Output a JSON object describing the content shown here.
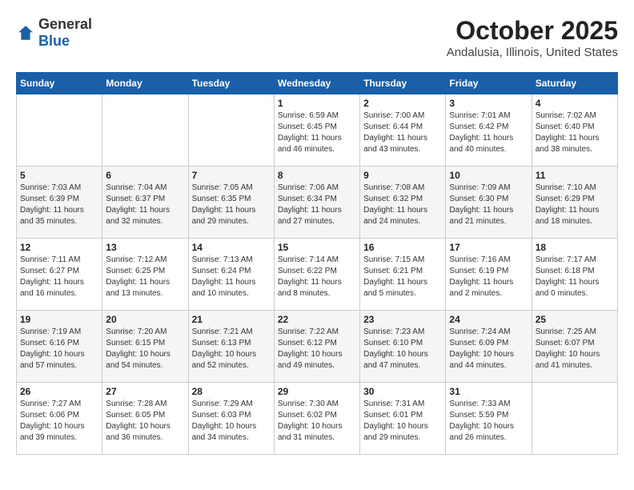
{
  "logo": {
    "general": "General",
    "blue": "Blue"
  },
  "title": "October 2025",
  "subtitle": "Andalusia, Illinois, United States",
  "days_of_week": [
    "Sunday",
    "Monday",
    "Tuesday",
    "Wednesday",
    "Thursday",
    "Friday",
    "Saturday"
  ],
  "weeks": [
    [
      {
        "day": "",
        "info": ""
      },
      {
        "day": "",
        "info": ""
      },
      {
        "day": "",
        "info": ""
      },
      {
        "day": "1",
        "info": "Sunrise: 6:59 AM\nSunset: 6:45 PM\nDaylight: 11 hours and 46 minutes."
      },
      {
        "day": "2",
        "info": "Sunrise: 7:00 AM\nSunset: 6:44 PM\nDaylight: 11 hours and 43 minutes."
      },
      {
        "day": "3",
        "info": "Sunrise: 7:01 AM\nSunset: 6:42 PM\nDaylight: 11 hours and 40 minutes."
      },
      {
        "day": "4",
        "info": "Sunrise: 7:02 AM\nSunset: 6:40 PM\nDaylight: 11 hours and 38 minutes."
      }
    ],
    [
      {
        "day": "5",
        "info": "Sunrise: 7:03 AM\nSunset: 6:39 PM\nDaylight: 11 hours and 35 minutes."
      },
      {
        "day": "6",
        "info": "Sunrise: 7:04 AM\nSunset: 6:37 PM\nDaylight: 11 hours and 32 minutes."
      },
      {
        "day": "7",
        "info": "Sunrise: 7:05 AM\nSunset: 6:35 PM\nDaylight: 11 hours and 29 minutes."
      },
      {
        "day": "8",
        "info": "Sunrise: 7:06 AM\nSunset: 6:34 PM\nDaylight: 11 hours and 27 minutes."
      },
      {
        "day": "9",
        "info": "Sunrise: 7:08 AM\nSunset: 6:32 PM\nDaylight: 11 hours and 24 minutes."
      },
      {
        "day": "10",
        "info": "Sunrise: 7:09 AM\nSunset: 6:30 PM\nDaylight: 11 hours and 21 minutes."
      },
      {
        "day": "11",
        "info": "Sunrise: 7:10 AM\nSunset: 6:29 PM\nDaylight: 11 hours and 18 minutes."
      }
    ],
    [
      {
        "day": "12",
        "info": "Sunrise: 7:11 AM\nSunset: 6:27 PM\nDaylight: 11 hours and 16 minutes."
      },
      {
        "day": "13",
        "info": "Sunrise: 7:12 AM\nSunset: 6:25 PM\nDaylight: 11 hours and 13 minutes."
      },
      {
        "day": "14",
        "info": "Sunrise: 7:13 AM\nSunset: 6:24 PM\nDaylight: 11 hours and 10 minutes."
      },
      {
        "day": "15",
        "info": "Sunrise: 7:14 AM\nSunset: 6:22 PM\nDaylight: 11 hours and 8 minutes."
      },
      {
        "day": "16",
        "info": "Sunrise: 7:15 AM\nSunset: 6:21 PM\nDaylight: 11 hours and 5 minutes."
      },
      {
        "day": "17",
        "info": "Sunrise: 7:16 AM\nSunset: 6:19 PM\nDaylight: 11 hours and 2 minutes."
      },
      {
        "day": "18",
        "info": "Sunrise: 7:17 AM\nSunset: 6:18 PM\nDaylight: 11 hours and 0 minutes."
      }
    ],
    [
      {
        "day": "19",
        "info": "Sunrise: 7:19 AM\nSunset: 6:16 PM\nDaylight: 10 hours and 57 minutes."
      },
      {
        "day": "20",
        "info": "Sunrise: 7:20 AM\nSunset: 6:15 PM\nDaylight: 10 hours and 54 minutes."
      },
      {
        "day": "21",
        "info": "Sunrise: 7:21 AM\nSunset: 6:13 PM\nDaylight: 10 hours and 52 minutes."
      },
      {
        "day": "22",
        "info": "Sunrise: 7:22 AM\nSunset: 6:12 PM\nDaylight: 10 hours and 49 minutes."
      },
      {
        "day": "23",
        "info": "Sunrise: 7:23 AM\nSunset: 6:10 PM\nDaylight: 10 hours and 47 minutes."
      },
      {
        "day": "24",
        "info": "Sunrise: 7:24 AM\nSunset: 6:09 PM\nDaylight: 10 hours and 44 minutes."
      },
      {
        "day": "25",
        "info": "Sunrise: 7:25 AM\nSunset: 6:07 PM\nDaylight: 10 hours and 41 minutes."
      }
    ],
    [
      {
        "day": "26",
        "info": "Sunrise: 7:27 AM\nSunset: 6:06 PM\nDaylight: 10 hours and 39 minutes."
      },
      {
        "day": "27",
        "info": "Sunrise: 7:28 AM\nSunset: 6:05 PM\nDaylight: 10 hours and 36 minutes."
      },
      {
        "day": "28",
        "info": "Sunrise: 7:29 AM\nSunset: 6:03 PM\nDaylight: 10 hours and 34 minutes."
      },
      {
        "day": "29",
        "info": "Sunrise: 7:30 AM\nSunset: 6:02 PM\nDaylight: 10 hours and 31 minutes."
      },
      {
        "day": "30",
        "info": "Sunrise: 7:31 AM\nSunset: 6:01 PM\nDaylight: 10 hours and 29 minutes."
      },
      {
        "day": "31",
        "info": "Sunrise: 7:33 AM\nSunset: 5:59 PM\nDaylight: 10 hours and 26 minutes."
      },
      {
        "day": "",
        "info": ""
      }
    ]
  ]
}
